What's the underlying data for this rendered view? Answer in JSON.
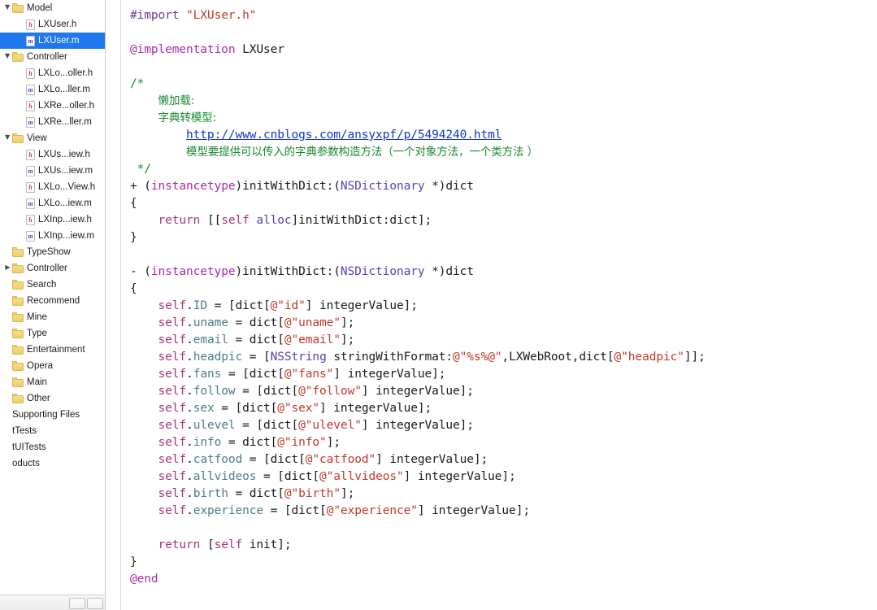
{
  "navigator": {
    "rows": [
      {
        "kind": "folder",
        "label": "Model",
        "indent": 0,
        "disclosure": "open",
        "selected": false
      },
      {
        "kind": "file-h",
        "label": "LXUser.h",
        "indent": 1,
        "disclosure": "none",
        "selected": false
      },
      {
        "kind": "file-m",
        "label": "LXUser.m",
        "indent": 1,
        "disclosure": "none",
        "selected": true
      },
      {
        "kind": "folder",
        "label": "Controller",
        "indent": 0,
        "disclosure": "open",
        "selected": false
      },
      {
        "kind": "file-h",
        "label": "LXLo...oller.h",
        "indent": 1,
        "disclosure": "none",
        "selected": false
      },
      {
        "kind": "file-m",
        "label": "LXLo...ller.m",
        "indent": 1,
        "disclosure": "none",
        "selected": false
      },
      {
        "kind": "file-h",
        "label": "LXRe...oller.h",
        "indent": 1,
        "disclosure": "none",
        "selected": false
      },
      {
        "kind": "file-m",
        "label": "LXRe...ller.m",
        "indent": 1,
        "disclosure": "none",
        "selected": false
      },
      {
        "kind": "folder",
        "label": "View",
        "indent": 0,
        "disclosure": "open",
        "selected": false
      },
      {
        "kind": "file-h",
        "label": "LXUs...iew.h",
        "indent": 1,
        "disclosure": "none",
        "selected": false
      },
      {
        "kind": "file-m",
        "label": "LXUs...iew.m",
        "indent": 1,
        "disclosure": "none",
        "selected": false
      },
      {
        "kind": "file-h",
        "label": "LXLo...View.h",
        "indent": 1,
        "disclosure": "none",
        "selected": false
      },
      {
        "kind": "file-m",
        "label": "LXLo...iew.m",
        "indent": 1,
        "disclosure": "none",
        "selected": false
      },
      {
        "kind": "file-h",
        "label": "LXInp...iew.h",
        "indent": 1,
        "disclosure": "none",
        "selected": false
      },
      {
        "kind": "file-m",
        "label": "LXInp...iew.m",
        "indent": 1,
        "disclosure": "none",
        "selected": false
      },
      {
        "kind": "folder",
        "label": "TypeShow",
        "indent": 0,
        "disclosure": "none",
        "selected": false
      },
      {
        "kind": "folder",
        "label": "Controller",
        "indent": 0,
        "disclosure": "closed",
        "selected": false
      },
      {
        "kind": "folder",
        "label": "Search",
        "indent": 0,
        "disclosure": "none",
        "selected": false
      },
      {
        "kind": "folder",
        "label": "Recommend",
        "indent": 0,
        "disclosure": "none",
        "selected": false
      },
      {
        "kind": "folder",
        "label": "Mine",
        "indent": 0,
        "disclosure": "none",
        "selected": false
      },
      {
        "kind": "folder",
        "label": "Type",
        "indent": 0,
        "disclosure": "none",
        "selected": false
      },
      {
        "kind": "folder",
        "label": "Entertainment",
        "indent": 0,
        "disclosure": "none",
        "selected": false
      },
      {
        "kind": "folder",
        "label": "Opera",
        "indent": 0,
        "disclosure": "none",
        "selected": false
      },
      {
        "kind": "folder",
        "label": "Main",
        "indent": 0,
        "disclosure": "none",
        "selected": false
      },
      {
        "kind": "folder",
        "label": "Other",
        "indent": 0,
        "disclosure": "none",
        "selected": false
      },
      {
        "kind": "text",
        "label": "Supporting Files",
        "indent": 0,
        "disclosure": "none",
        "selected": false
      },
      {
        "kind": "text",
        "label": "tTests",
        "indent": 0,
        "disclosure": "none",
        "selected": false
      },
      {
        "kind": "text",
        "label": "tUITests",
        "indent": 0,
        "disclosure": "none",
        "selected": false
      },
      {
        "kind": "text",
        "label": "oducts",
        "indent": 0,
        "disclosure": "none",
        "selected": false
      }
    ],
    "selected_file": "LXUser.m"
  },
  "editor": {
    "filename": "LXUser.m",
    "language": "objective-c",
    "code_lines": [
      [
        {
          "t": "#import ",
          "c": "c-pre"
        },
        {
          "t": "\"LXUser.h\"",
          "c": "c-str"
        }
      ],
      [],
      [
        {
          "t": "@implementation",
          "c": "c-key"
        },
        {
          "t": " LXUser",
          "c": "c-plain"
        }
      ],
      [],
      [
        {
          "t": "/*",
          "c": "c-cmt"
        }
      ],
      [
        {
          "t": "    ",
          "c": "c-cmt"
        },
        {
          "t": "懒加载:",
          "c": "c-cmt cjk"
        }
      ],
      [
        {
          "t": "    ",
          "c": "c-cmt"
        },
        {
          "t": "字典转模型:",
          "c": "c-cmt cjk"
        }
      ],
      [
        {
          "t": "        ",
          "c": "c-cmt"
        },
        {
          "t": "http://www.cnblogs.com/ansyxpf/p/5494240.html",
          "c": "c-link"
        }
      ],
      [
        {
          "t": "        ",
          "c": "c-cmt"
        },
        {
          "t": "模型要提供可以传入的字典参数构造方法（一个对象方法，一个类方法 ）",
          "c": "c-cmt cjk"
        }
      ],
      [
        {
          "t": " */",
          "c": "c-cmt"
        }
      ],
      [
        {
          "t": "+ (",
          "c": "c-plain"
        },
        {
          "t": "instancetype",
          "c": "c-key"
        },
        {
          "t": ")initWithDict:(",
          "c": "c-plain"
        },
        {
          "t": "NSDictionary",
          "c": "c-type"
        },
        {
          "t": " *)dict",
          "c": "c-plain"
        }
      ],
      [
        {
          "t": "{",
          "c": "c-plain"
        }
      ],
      [
        {
          "t": "    ",
          "c": "c-plain"
        },
        {
          "t": "return",
          "c": "c-ret"
        },
        {
          "t": " [[",
          "c": "c-plain"
        },
        {
          "t": "self",
          "c": "c-ret"
        },
        {
          "t": " ",
          "c": "c-plain"
        },
        {
          "t": "alloc",
          "c": "c-type"
        },
        {
          "t": "]initWithDict:dict];",
          "c": "c-plain"
        }
      ],
      [
        {
          "t": "}",
          "c": "c-plain"
        }
      ],
      [],
      [
        {
          "t": "- (",
          "c": "c-plain"
        },
        {
          "t": "instancetype",
          "c": "c-key"
        },
        {
          "t": ")initWithDict:(",
          "c": "c-plain"
        },
        {
          "t": "NSDictionary",
          "c": "c-type"
        },
        {
          "t": " *)dict",
          "c": "c-plain"
        }
      ],
      [
        {
          "t": "{",
          "c": "c-plain"
        }
      ],
      [
        {
          "t": "    ",
          "c": "c-plain"
        },
        {
          "t": "self",
          "c": "c-self"
        },
        {
          "t": ".",
          "c": "c-plain"
        },
        {
          "t": "ID",
          "c": "c-prop"
        },
        {
          "t": " = [dict[",
          "c": "c-plain"
        },
        {
          "t": "@\"id\"",
          "c": "c-at"
        },
        {
          "t": "] integerValue];",
          "c": "c-plain"
        }
      ],
      [
        {
          "t": "    ",
          "c": "c-plain"
        },
        {
          "t": "self",
          "c": "c-self"
        },
        {
          "t": ".",
          "c": "c-plain"
        },
        {
          "t": "uname",
          "c": "c-prop"
        },
        {
          "t": " = dict[",
          "c": "c-plain"
        },
        {
          "t": "@\"uname\"",
          "c": "c-at"
        },
        {
          "t": "];",
          "c": "c-plain"
        }
      ],
      [
        {
          "t": "    ",
          "c": "c-plain"
        },
        {
          "t": "self",
          "c": "c-self"
        },
        {
          "t": ".",
          "c": "c-plain"
        },
        {
          "t": "email",
          "c": "c-prop"
        },
        {
          "t": " = dict[",
          "c": "c-plain"
        },
        {
          "t": "@\"email\"",
          "c": "c-at"
        },
        {
          "t": "];",
          "c": "c-plain"
        }
      ],
      [
        {
          "t": "    ",
          "c": "c-plain"
        },
        {
          "t": "self",
          "c": "c-self"
        },
        {
          "t": ".",
          "c": "c-plain"
        },
        {
          "t": "headpic",
          "c": "c-prop"
        },
        {
          "t": " = [",
          "c": "c-plain"
        },
        {
          "t": "NSString",
          "c": "c-type"
        },
        {
          "t": " stringWithFormat:",
          "c": "c-plain"
        },
        {
          "t": "@\"%s%@\"",
          "c": "c-at"
        },
        {
          "t": ",LXWebRoot,dict[",
          "c": "c-plain"
        },
        {
          "t": "@\"headpic\"",
          "c": "c-at"
        },
        {
          "t": "]];",
          "c": "c-plain"
        }
      ],
      [
        {
          "t": "    ",
          "c": "c-plain"
        },
        {
          "t": "self",
          "c": "c-self"
        },
        {
          "t": ".",
          "c": "c-plain"
        },
        {
          "t": "fans",
          "c": "c-prop"
        },
        {
          "t": " = [dict[",
          "c": "c-plain"
        },
        {
          "t": "@\"fans\"",
          "c": "c-at"
        },
        {
          "t": "] integerValue];",
          "c": "c-plain"
        }
      ],
      [
        {
          "t": "    ",
          "c": "c-plain"
        },
        {
          "t": "self",
          "c": "c-self"
        },
        {
          "t": ".",
          "c": "c-plain"
        },
        {
          "t": "follow",
          "c": "c-prop"
        },
        {
          "t": " = [dict[",
          "c": "c-plain"
        },
        {
          "t": "@\"follow\"",
          "c": "c-at"
        },
        {
          "t": "] integerValue];",
          "c": "c-plain"
        }
      ],
      [
        {
          "t": "    ",
          "c": "c-plain"
        },
        {
          "t": "self",
          "c": "c-self"
        },
        {
          "t": ".",
          "c": "c-plain"
        },
        {
          "t": "sex",
          "c": "c-prop"
        },
        {
          "t": " = [dict[",
          "c": "c-plain"
        },
        {
          "t": "@\"sex\"",
          "c": "c-at"
        },
        {
          "t": "] integerValue];",
          "c": "c-plain"
        }
      ],
      [
        {
          "t": "    ",
          "c": "c-plain"
        },
        {
          "t": "self",
          "c": "c-self"
        },
        {
          "t": ".",
          "c": "c-plain"
        },
        {
          "t": "ulevel",
          "c": "c-prop"
        },
        {
          "t": " = [dict[",
          "c": "c-plain"
        },
        {
          "t": "@\"ulevel\"",
          "c": "c-at"
        },
        {
          "t": "] integerValue];",
          "c": "c-plain"
        }
      ],
      [
        {
          "t": "    ",
          "c": "c-plain"
        },
        {
          "t": "self",
          "c": "c-self"
        },
        {
          "t": ".",
          "c": "c-plain"
        },
        {
          "t": "info",
          "c": "c-prop"
        },
        {
          "t": " = dict[",
          "c": "c-plain"
        },
        {
          "t": "@\"info\"",
          "c": "c-at"
        },
        {
          "t": "];",
          "c": "c-plain"
        }
      ],
      [
        {
          "t": "    ",
          "c": "c-plain"
        },
        {
          "t": "self",
          "c": "c-self"
        },
        {
          "t": ".",
          "c": "c-plain"
        },
        {
          "t": "catfood",
          "c": "c-prop"
        },
        {
          "t": " = [dict[",
          "c": "c-plain"
        },
        {
          "t": "@\"catfood\"",
          "c": "c-at"
        },
        {
          "t": "] integerValue];",
          "c": "c-plain"
        }
      ],
      [
        {
          "t": "    ",
          "c": "c-plain"
        },
        {
          "t": "self",
          "c": "c-self"
        },
        {
          "t": ".",
          "c": "c-plain"
        },
        {
          "t": "allvideos",
          "c": "c-prop"
        },
        {
          "t": " = [dict[",
          "c": "c-plain"
        },
        {
          "t": "@\"allvideos\"",
          "c": "c-at"
        },
        {
          "t": "] integerValue];",
          "c": "c-plain"
        }
      ],
      [
        {
          "t": "    ",
          "c": "c-plain"
        },
        {
          "t": "self",
          "c": "c-self"
        },
        {
          "t": ".",
          "c": "c-plain"
        },
        {
          "t": "birth",
          "c": "c-prop"
        },
        {
          "t": " = dict[",
          "c": "c-plain"
        },
        {
          "t": "@\"birth\"",
          "c": "c-at"
        },
        {
          "t": "];",
          "c": "c-plain"
        }
      ],
      [
        {
          "t": "    ",
          "c": "c-plain"
        },
        {
          "t": "self",
          "c": "c-self"
        },
        {
          "t": ".",
          "c": "c-plain"
        },
        {
          "t": "experience",
          "c": "c-prop"
        },
        {
          "t": " = [dict[",
          "c": "c-plain"
        },
        {
          "t": "@\"experience\"",
          "c": "c-at"
        },
        {
          "t": "] integerValue];",
          "c": "c-plain"
        }
      ],
      [],
      [
        {
          "t": "    ",
          "c": "c-plain"
        },
        {
          "t": "return",
          "c": "c-ret"
        },
        {
          "t": " [",
          "c": "c-plain"
        },
        {
          "t": "self",
          "c": "c-ret"
        },
        {
          "t": " init];",
          "c": "c-plain"
        }
      ],
      [
        {
          "t": "}",
          "c": "c-plain"
        }
      ],
      [
        {
          "t": "@end",
          "c": "c-key"
        }
      ]
    ]
  },
  "colors": {
    "selection": "#1f78f0",
    "comment": "#178a2d",
    "string": "#c0392b",
    "keyword": "#aa2bb0",
    "type": "#5a3fb5",
    "link": "#1236cf",
    "property": "#4a7d86",
    "self": "#a8337a",
    "folder": "#f2d57d",
    "editor_bg": "#ffffff"
  }
}
